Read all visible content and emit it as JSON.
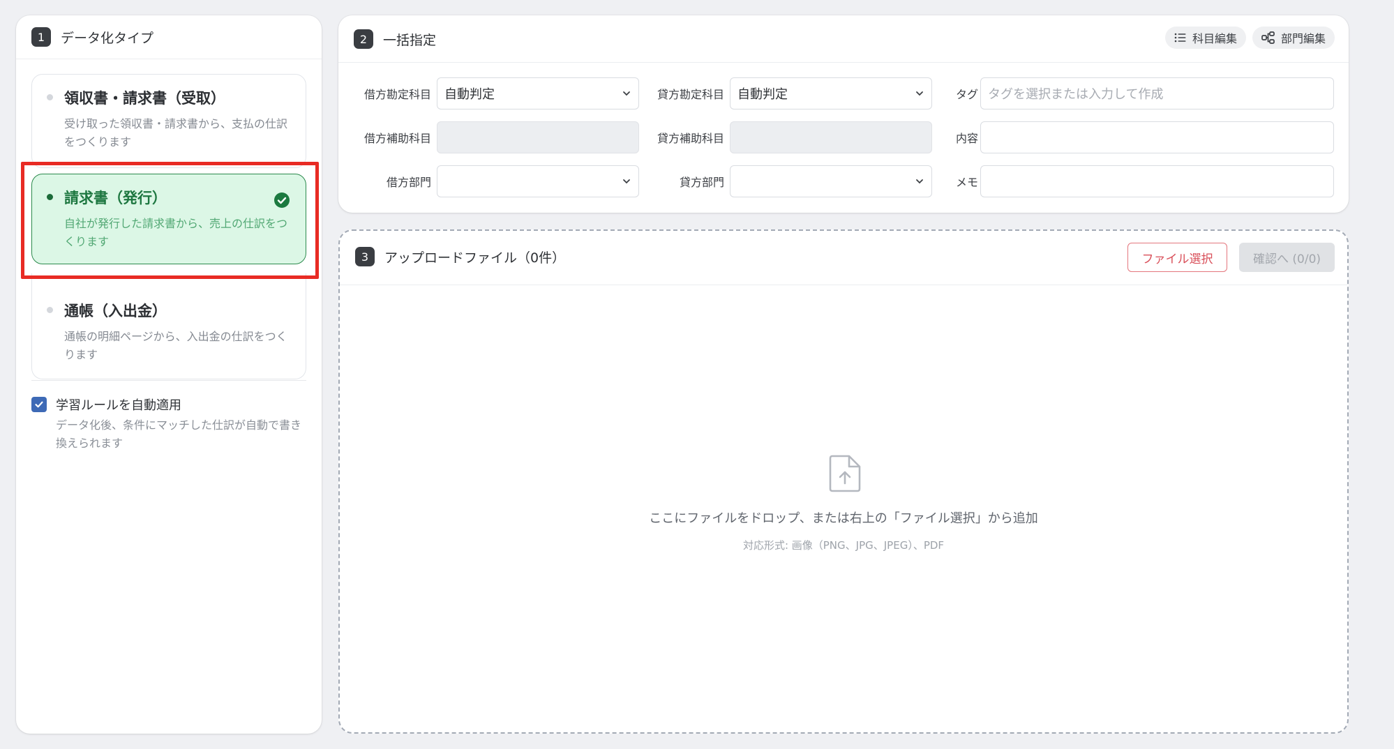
{
  "left": {
    "step_number": "1",
    "title": "データ化タイプ",
    "types": [
      {
        "title": "領収書・請求書（受取）",
        "desc": "受け取った領収書・請求書から、支払の仕訳をつくります",
        "selected": false
      },
      {
        "title": "請求書（発行）",
        "desc": "自社が発行した請求書から、売上の仕訳をつくります",
        "selected": true
      },
      {
        "title": "通帳（入出金）",
        "desc": "通帳の明細ページから、入出金の仕訳をつくります",
        "selected": false
      }
    ],
    "auto_rule": {
      "label": "学習ルールを自動適用",
      "desc": "データ化後、条件にマッチした仕訳が自動で書き換えられます",
      "checked": true
    }
  },
  "batch": {
    "step_number": "2",
    "title": "一括指定",
    "edit_accounts_label": "科目編集",
    "edit_departments_label": "部門編集",
    "debit_account": {
      "label": "借方勘定科目",
      "value": "自動判定"
    },
    "credit_account": {
      "label": "貸方勘定科目",
      "value": "自動判定"
    },
    "tag": {
      "label": "タグ",
      "placeholder": "タグを選択または入力して作成"
    },
    "debit_sub_account": {
      "label": "借方補助科目",
      "value": ""
    },
    "credit_sub_account": {
      "label": "貸方補助科目",
      "value": ""
    },
    "content": {
      "label": "内容",
      "value": ""
    },
    "debit_department": {
      "label": "借方部門",
      "value": ""
    },
    "credit_department": {
      "label": "貸方部門",
      "value": ""
    },
    "memo": {
      "label": "メモ",
      "value": ""
    }
  },
  "upload": {
    "step_number": "3",
    "title": "アップロードファイル（0件）",
    "file_select_label": "ファイル選択",
    "confirm_label": "確認へ (0/0)",
    "drop_text": "ここにファイルをドロップ、または右上の「ファイル選択」から追加",
    "formats_text": "対応形式: 画像（PNG、JPG、JPEG）、PDF"
  },
  "colors": {
    "selected_bg": "#dcf7e6",
    "selected_accent": "#1d7740",
    "highlight": "#e82b24",
    "checkbox": "#3e6ab6",
    "file_button": "#d9505a"
  }
}
